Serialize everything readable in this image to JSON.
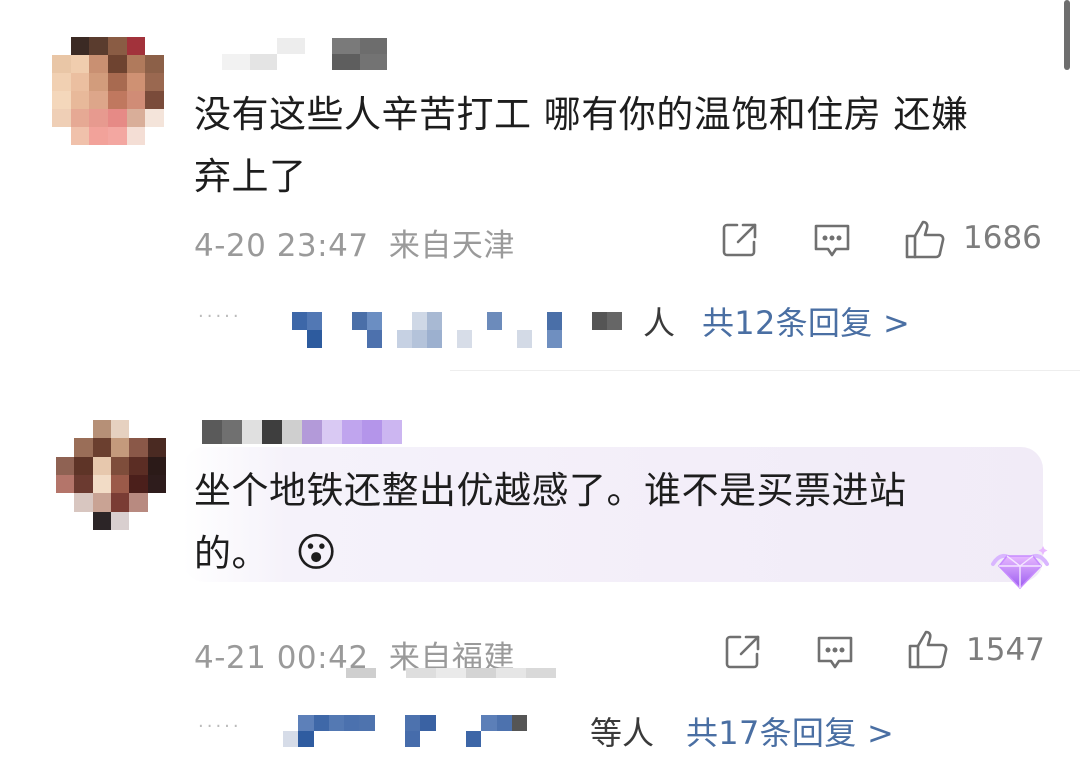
{
  "comments": [
    {
      "text_line1": "没有这些人辛苦打工 哪有你的温饱和住房 还嫌",
      "text_line2": "弃上了",
      "time": "4-20 23:47",
      "location": "来自天津",
      "likes": "1686",
      "replies_suffix": "人",
      "replies_link": "共12条回复 >"
    },
    {
      "text_line1": "坐个地铁还整出优越感了。谁不是买票进站",
      "text_line2": "的。",
      "emoji": "😮",
      "time": "4-21 00:42",
      "location": "来自福建",
      "likes": "1547",
      "replies_suffix": "等人",
      "replies_link": "共17条回复 >"
    }
  ],
  "more_dots": "·····",
  "icons": [
    "share-icon",
    "comment-icon",
    "like-icon",
    "vip-diamond-badge-icon"
  ],
  "colors": {
    "link": "#4a6fa3",
    "meta": "#9a9a9a",
    "highlight": "#f3eef9"
  }
}
